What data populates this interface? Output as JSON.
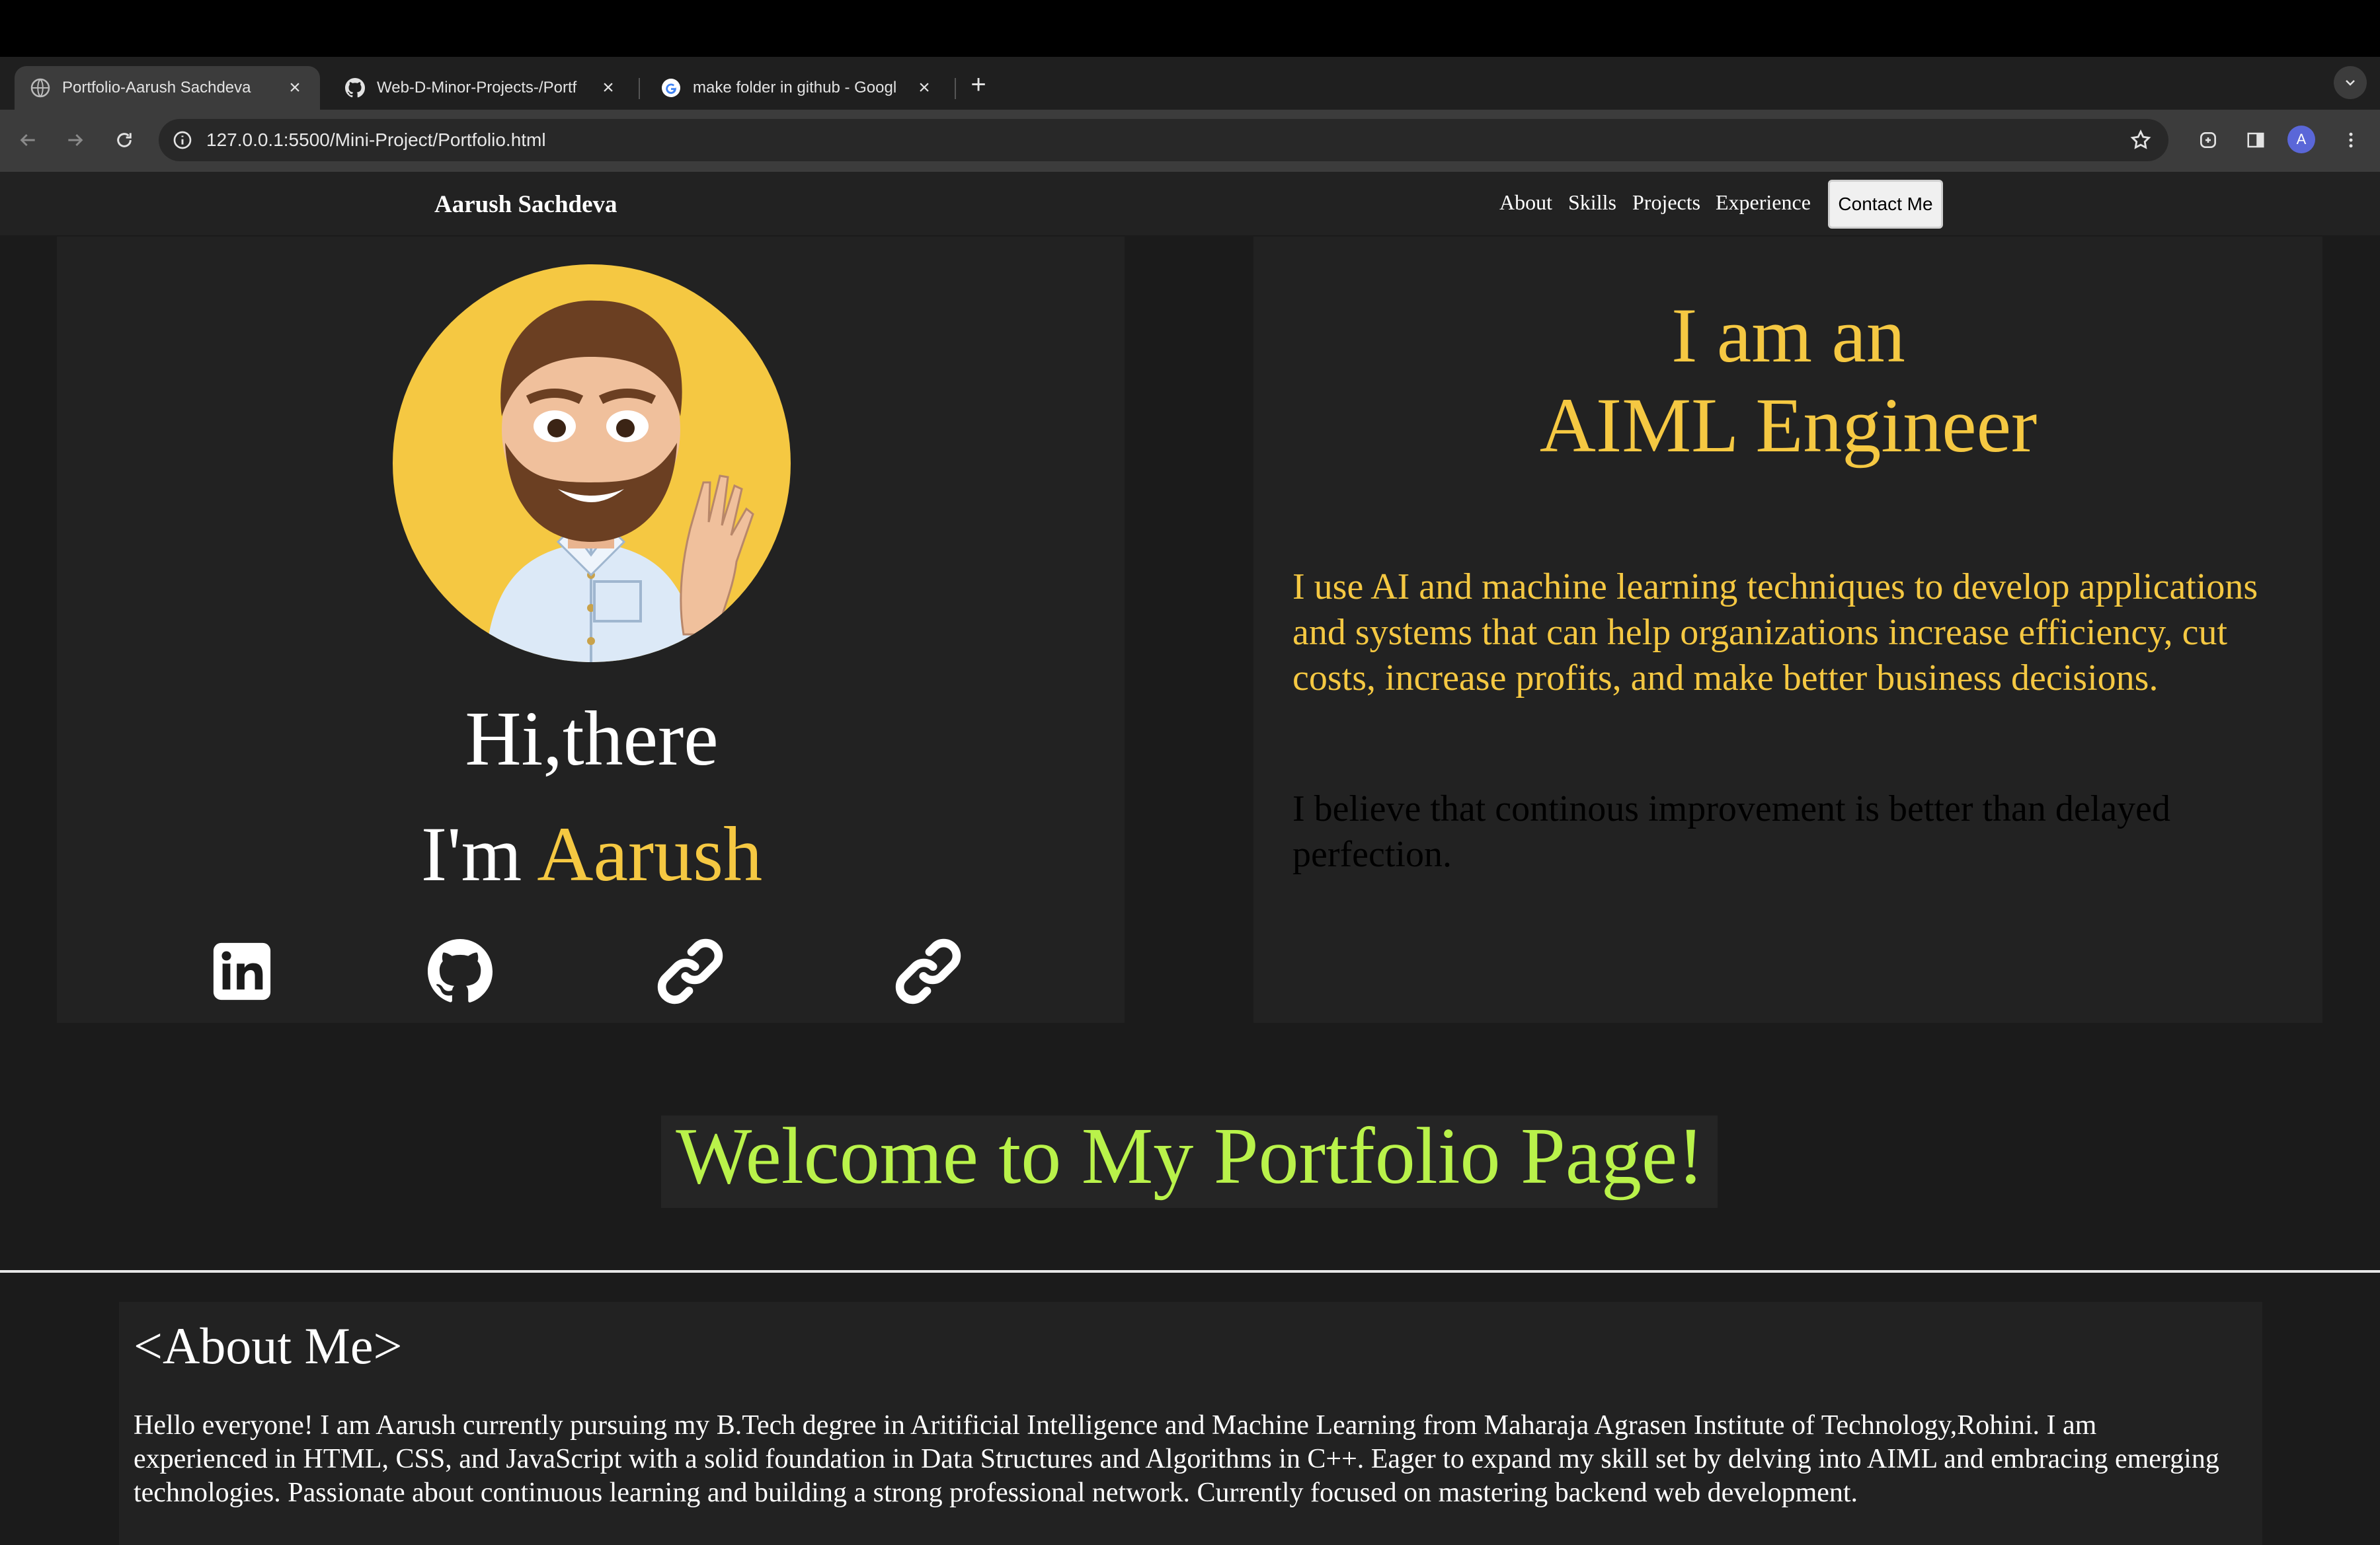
{
  "browser": {
    "tabs": [
      {
        "title": "Portfolio-Aarush Sachdeva",
        "active": true,
        "icon": "globe-icon"
      },
      {
        "title": "Web-D-Minor-Projects-/Portf",
        "active": false,
        "icon": "github-icon"
      },
      {
        "title": "make folder in github - Googl",
        "active": false,
        "icon": "google-icon"
      }
    ],
    "new_tab": "+",
    "url": "127.0.0.1:5500/Mini-Project/Portfolio.html",
    "profile_initial": "A"
  },
  "page": {
    "nav": {
      "brand": "Aarush Sachdeva",
      "links": [
        "About",
        "Skills",
        "Projects",
        "Experience"
      ],
      "contact": "Contact Me"
    },
    "hero": {
      "greeting": "Hi,there",
      "im": "I'm ",
      "name": "Aarush",
      "social_icons": [
        "linkedin-icon",
        "github-icon",
        "link-icon",
        "link-icon"
      ],
      "role_line1": "I am an",
      "role_line2": "AIML Engineer",
      "bio": "I use AI and machine learning techniques to develop applications and systems that can help organizations increase efficiency, cut costs, increase profits, and make better business decisions.",
      "quote": "I believe that continous improvement is better than delayed perfection."
    },
    "welcome": "Welcome to My Portfolio Page!",
    "about": {
      "title": "<About Me>",
      "text": "Hello everyone! I am Aarush currently pursuing my B.Tech degree in Aritificial Intelligence and Machine Learning from Maharaja Agrasen Institute of Technology,Rohini. I am experienced in HTML, CSS, and JavaScript with a solid foundation in Data Structures and Algorithms in C++. Eager to expand my skill set by delving into AIML and embracing emerging technologies. Passionate about continuous learning and building a strong professional network. Currently focused on mastering backend web development."
    }
  },
  "colors": {
    "accent_yellow": "#f5c842",
    "welcome_green": "#b9f24a",
    "page_bg": "#1b1b1b",
    "panel_bg": "#222222"
  }
}
